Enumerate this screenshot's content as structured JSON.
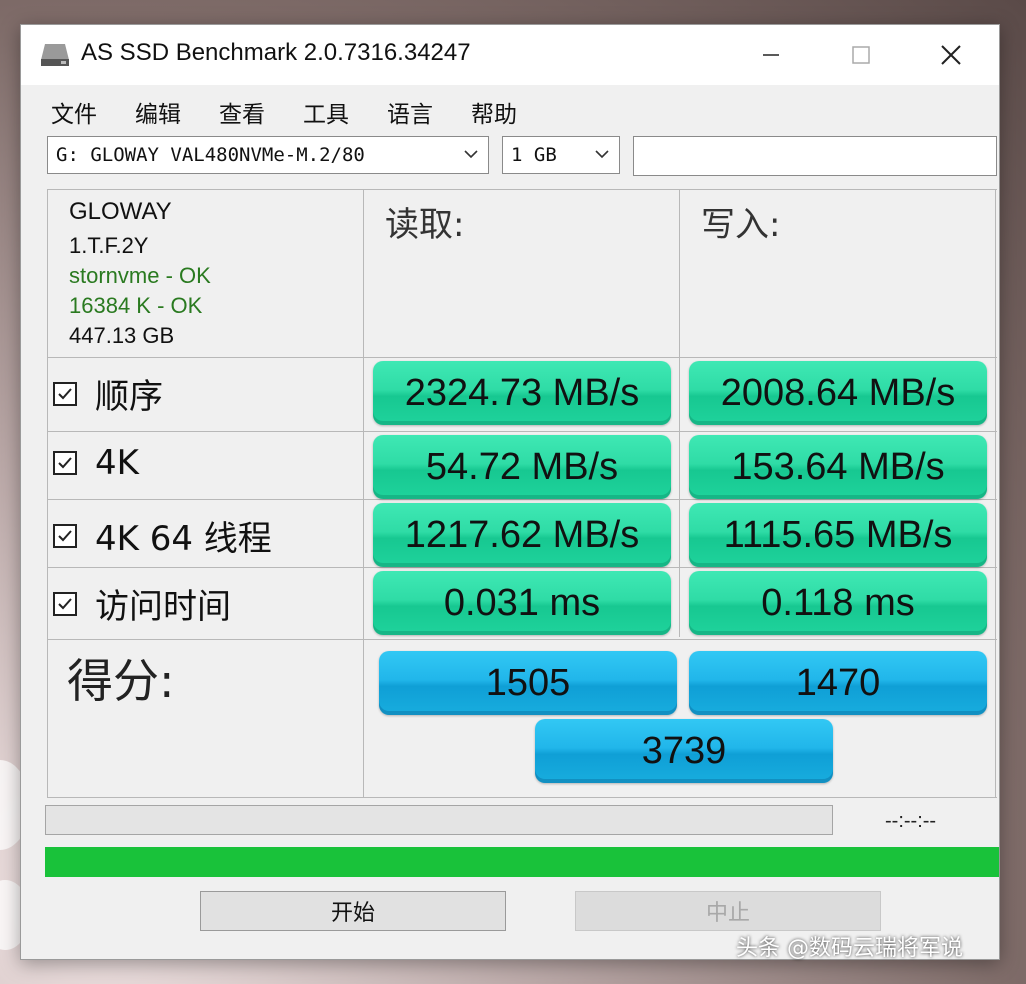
{
  "window": {
    "title": "AS SSD Benchmark 2.0.7316.34247"
  },
  "menu": [
    "文件",
    "编辑",
    "查看",
    "工具",
    "语言",
    "帮助"
  ],
  "drive_select": {
    "value": "G: GLOWAY VAL480NVMe-M.2/80"
  },
  "size_select": {
    "value": "1 GB"
  },
  "drive_info": {
    "name": "GLOWAY",
    "firmware": "1.T.F.2Y",
    "driver": "stornvme - OK",
    "alignment": "16384 K - OK",
    "capacity": "447.13 GB"
  },
  "columns": {
    "read": "读取:",
    "write": "写入:"
  },
  "rows": [
    {
      "label": "顺序",
      "checked": true,
      "read": "2324.73 MB/s",
      "write": "2008.64 MB/s"
    },
    {
      "label": "4K",
      "checked": true,
      "read": "54.72 MB/s",
      "write": "153.64 MB/s"
    },
    {
      "label": "4K 64 线程",
      "checked": true,
      "read": "1217.62 MB/s",
      "write": "1115.65 MB/s"
    },
    {
      "label": "访问时间",
      "checked": true,
      "read": "0.031 ms",
      "write": "0.118 ms"
    }
  ],
  "score": {
    "label": "得分:",
    "read": "1505",
    "write": "1470",
    "total": "3739"
  },
  "progress": {
    "timer": "--:--:--",
    "main_fraction": 1.0
  },
  "buttons": {
    "start": "开始",
    "stop": "中止"
  },
  "watermark": "头条 @数码云瑞将军说",
  "colors": {
    "result_green": "#2fdca6",
    "score_blue": "#21b6ea",
    "progress_green": "#19c23a"
  }
}
